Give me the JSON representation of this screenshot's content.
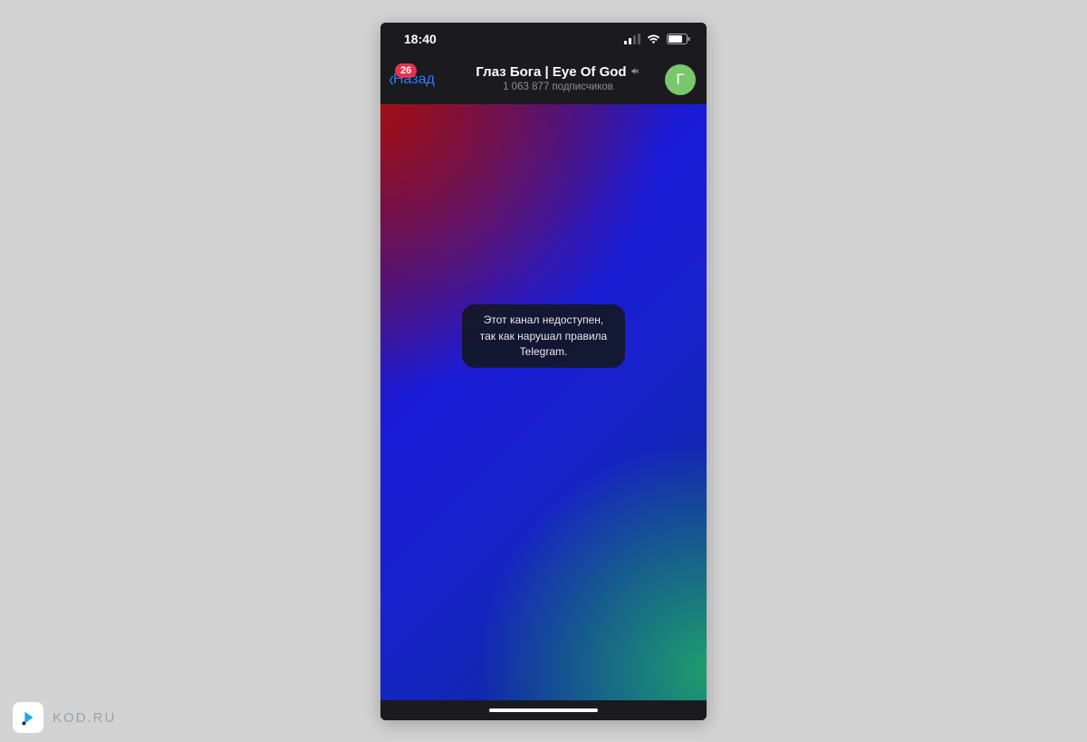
{
  "statusbar": {
    "time": "18:40"
  },
  "navbar": {
    "back_label": "Назад",
    "badge_count": "26",
    "title": "Глаз Бога | Eye Of God",
    "subtitle": "1 063 877 подписчиков",
    "avatar_letter": "Г"
  },
  "chat": {
    "unavailable_message": "Этот канал недоступен, так как нарушал правила Telegram."
  },
  "watermark": {
    "label": "KOD.RU"
  },
  "colors": {
    "badge": "#e63450",
    "link": "#2f7cf6",
    "avatar": "#7ac66b"
  }
}
